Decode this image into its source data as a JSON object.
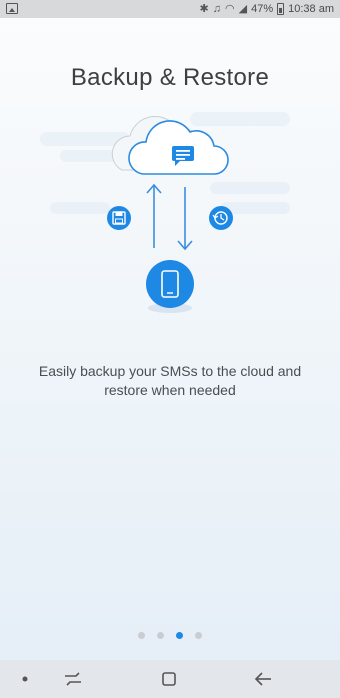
{
  "status_bar": {
    "battery": "47%",
    "time": "10:38 am",
    "icons": [
      "gallery-icon",
      "bluetooth-icon",
      "mute-icon",
      "wifi-icon",
      "signal-icon",
      "battery-icon"
    ]
  },
  "onboarding": {
    "title": "Backup & Restore",
    "description": "Easily backup your SMSs to the cloud and restore when needed",
    "page_count": 4,
    "active_page": 3
  },
  "colors": {
    "accent": "#1e88e5",
    "title_text": "#3d3f41",
    "body_text": "#4b4d50"
  },
  "nav_bar": {
    "icons": [
      "home-dot-icon",
      "recents-icon",
      "home-icon",
      "back-icon"
    ]
  }
}
